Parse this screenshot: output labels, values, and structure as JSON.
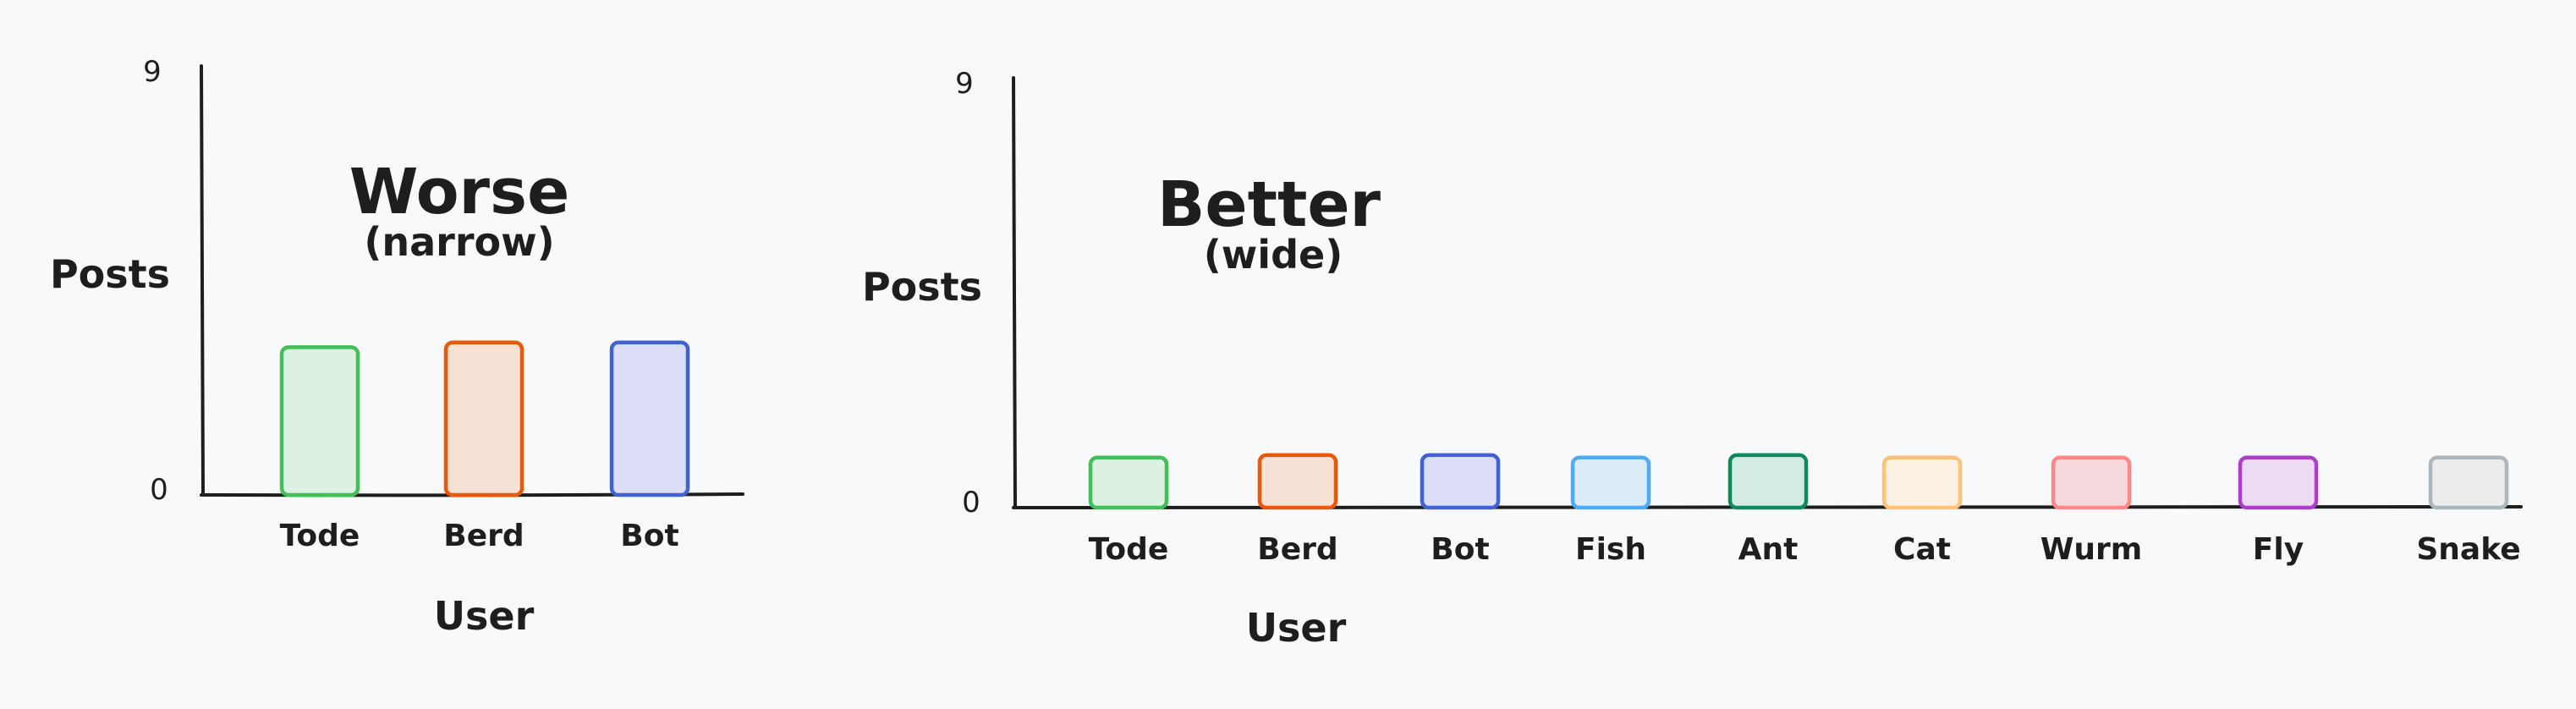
{
  "chart_data": [
    {
      "type": "bar",
      "title": "Worse",
      "subtitle": "(narrow)",
      "xlabel": "User",
      "ylabel": "Posts",
      "ylim": [
        0,
        9
      ],
      "yticks": [
        "0",
        "9"
      ],
      "categories": [
        "Tode",
        "Berd",
        "Bot"
      ],
      "values": [
        3.1,
        3.2,
        3.2
      ],
      "colors": [
        {
          "stroke": "#40c057",
          "fill": "#dcf1e1"
        },
        {
          "stroke": "#e8590c",
          "fill": "#f8e2d5"
        },
        {
          "stroke": "#4262d3",
          "fill": "#dbdef6"
        }
      ],
      "grid": false
    },
    {
      "type": "bar",
      "title": "Better",
      "subtitle": "(wide)",
      "xlabel": "User",
      "ylabel": "Posts",
      "ylim": [
        0,
        9
      ],
      "yticks": [
        "0",
        "9"
      ],
      "categories": [
        "Tode",
        "Berd",
        "Bot",
        "Fish",
        "Ant",
        "Cat",
        "Wurm",
        "Fly",
        "Snake"
      ],
      "values": [
        1.05,
        1.1,
        1.1,
        1.05,
        1.1,
        1.05,
        1.05,
        1.05,
        1.05
      ],
      "colors": [
        {
          "stroke": "#40c057",
          "fill": "#dcf1e1"
        },
        {
          "stroke": "#e8590c",
          "fill": "#f8e2d5"
        },
        {
          "stroke": "#4262d3",
          "fill": "#dbdef6"
        },
        {
          "stroke": "#4dabf7",
          "fill": "#dcecf9"
        },
        {
          "stroke": "#0c8a5e",
          "fill": "#d4ebe4"
        },
        {
          "stroke": "#ffc078",
          "fill": "#fbf1e3"
        },
        {
          "stroke": "#ff8787",
          "fill": "#f4d8dc"
        },
        {
          "stroke": "#ae3ec9",
          "fill": "#ecdcf2"
        },
        {
          "stroke": "#adb5bd",
          "fill": "#ececed"
        }
      ],
      "grid": false
    }
  ]
}
